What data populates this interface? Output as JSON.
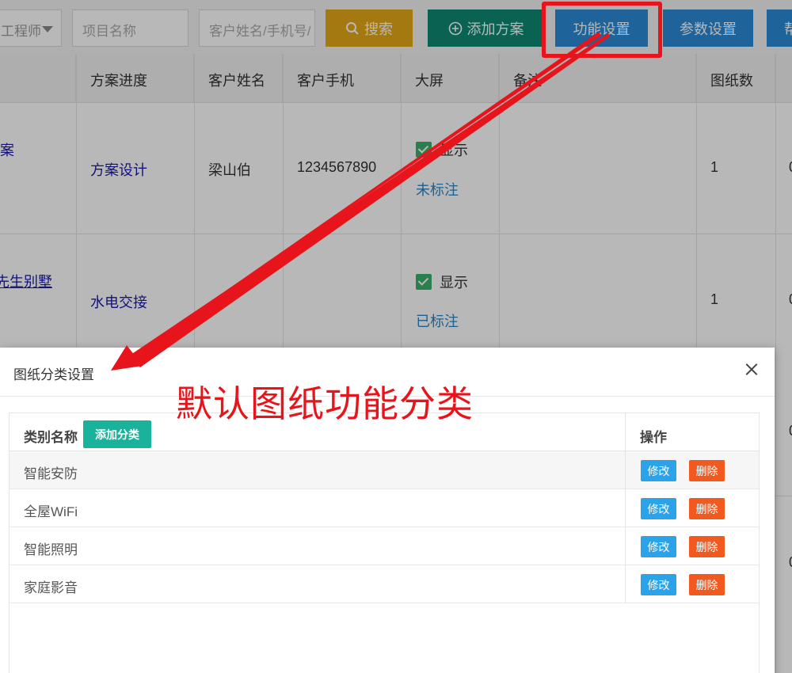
{
  "toolbar": {
    "engineer_select": "工程师",
    "project_placeholder": "项目名称",
    "customer_placeholder": "客户姓名/手机号/",
    "search_label": "搜索",
    "add_plan_label": "添加方案",
    "func_settings_label": "功能设置",
    "param_settings_label": "参数设置",
    "help_label": "帮"
  },
  "table": {
    "columns": [
      "方案进度",
      "客户姓名",
      "客户手机",
      "大屏",
      "备注",
      "图纸数"
    ],
    "rows": [
      {
        "name_fragment": "案",
        "progress": "方案设计",
        "customer": "梁山伯",
        "phone": "1234567890",
        "screen": "显示",
        "mark": "未标注",
        "drawings": "1",
        "extra": "0"
      },
      {
        "name_fragment": "先生别墅",
        "progress": "水电交接",
        "customer": "",
        "phone": "",
        "screen": "显示",
        "mark": "已标注",
        "drawings": "1",
        "extra": "0"
      }
    ],
    "side_digits": [
      "0",
      "0"
    ]
  },
  "modal": {
    "title": "图纸分类设置",
    "header_category": "类别名称",
    "add_category_label": "添加分类",
    "header_actions": "操作",
    "edit_label": "修改",
    "delete_label": "删除",
    "categories": [
      "智能安防",
      "全屋WiFi",
      "智能照明",
      "家庭影音"
    ]
  },
  "annotation": {
    "text": "默认图纸功能分类",
    "color": "#e8141b"
  }
}
